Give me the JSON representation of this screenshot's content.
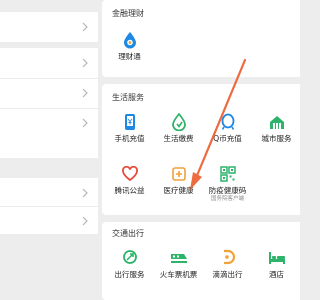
{
  "finance": {
    "title": "金融理财",
    "items": [
      {
        "label": "理财通",
        "icon": "wealth-drop-icon"
      }
    ]
  },
  "life": {
    "title": "生活服务",
    "items": [
      {
        "label": "手机充值",
        "icon": "phone-topup-icon"
      },
      {
        "label": "生活缴费",
        "icon": "utility-payment-icon"
      },
      {
        "label": "Q币充值",
        "icon": "qq-coin-icon"
      },
      {
        "label": "城市服务",
        "icon": "city-service-icon"
      },
      {
        "label": "腾讯公益",
        "icon": "charity-heart-icon"
      },
      {
        "label": "医疗健康",
        "icon": "medical-cross-icon"
      },
      {
        "label": "防疫健康码",
        "icon": "qr-code-icon",
        "sub": "国务院客户端"
      }
    ]
  },
  "transport": {
    "title": "交通出行",
    "items": [
      {
        "label": "出行服务",
        "icon": "transit-icon"
      },
      {
        "label": "火车票机票",
        "icon": "train-ticket-icon"
      },
      {
        "label": "滴滴出行",
        "icon": "didi-icon"
      },
      {
        "label": "酒店",
        "icon": "hotel-bed-icon"
      }
    ]
  },
  "colors": {
    "accent_green": "#2db36a",
    "accent_blue": "#1e88e5",
    "arrow": "#ee6a3f",
    "background": "#ededed"
  }
}
